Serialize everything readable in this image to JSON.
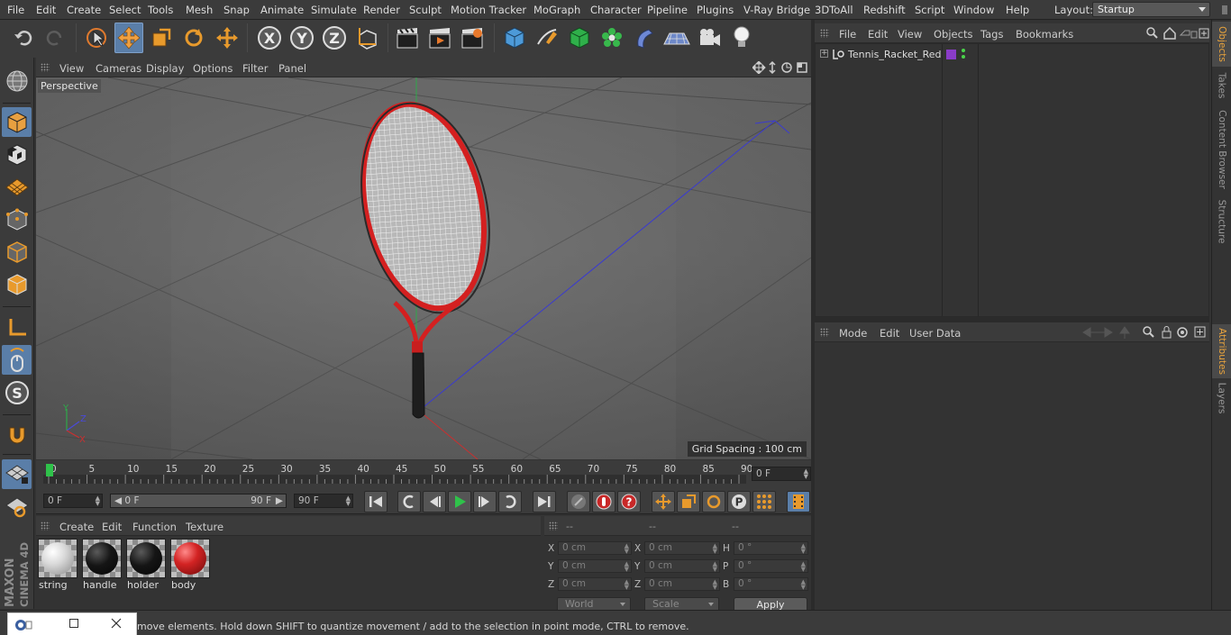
{
  "menubar": {
    "items": [
      "File",
      "Edit",
      "Create",
      "Select",
      "Tools",
      "Mesh",
      "Snap",
      "Animate",
      "Simulate",
      "Render",
      "Sculpt",
      "Motion Tracker",
      "MoGraph",
      "Character",
      "Pipeline",
      "Plugins",
      "V-Ray Bridge",
      "3DToAll",
      "Redshift",
      "Script",
      "Window",
      "Help"
    ],
    "layout_label": "Layout:",
    "layout_value": "Startup"
  },
  "viewport": {
    "menu": [
      "View",
      "Cameras",
      "Display",
      "Options",
      "Filter",
      "Panel"
    ],
    "label": "Perspective",
    "grid_spacing": "Grid Spacing : 100 cm",
    "axis_labels": {
      "y": "Y",
      "z": "Z",
      "x": "X"
    }
  },
  "timeline": {
    "ticks": [
      "0",
      "5",
      "10",
      "15",
      "20",
      "25",
      "30",
      "35",
      "40",
      "45",
      "50",
      "55",
      "60",
      "65",
      "70",
      "75",
      "80",
      "85",
      "90"
    ],
    "current_frame": "0 F",
    "start_field": "0 F",
    "range_start": "0 F",
    "range_end": "90 F",
    "end_field": "90 F"
  },
  "materials": {
    "menu": [
      "Create",
      "Edit",
      "Function",
      "Texture"
    ],
    "items": [
      {
        "name": "string",
        "color": "#d9d9d9"
      },
      {
        "name": "handle",
        "color": "#151515"
      },
      {
        "name": "holder",
        "color": "#151515"
      },
      {
        "name": "body",
        "color": "#d32323"
      }
    ]
  },
  "coordinates": {
    "headers": [
      "--",
      "--",
      "--"
    ],
    "rows": [
      {
        "l1": "X",
        "v1": "0 cm",
        "l2": "X",
        "v2": "0 cm",
        "l3": "H",
        "v3": "0 °"
      },
      {
        "l1": "Y",
        "v1": "0 cm",
        "l2": "Y",
        "v2": "0 cm",
        "l3": "P",
        "v3": "0 °"
      },
      {
        "l1": "Z",
        "v1": "0 cm",
        "l2": "Z",
        "v2": "0 cm",
        "l3": "B",
        "v3": "0 °"
      }
    ],
    "space": "World",
    "mode": "Scale",
    "apply_label": "Apply"
  },
  "objects": {
    "menu": [
      "File",
      "Edit",
      "View",
      "Objects",
      "Tags",
      "Bookmarks"
    ],
    "items": [
      {
        "name": "Tennis_Racket_Red",
        "tag_color": "#8a3cc8"
      }
    ]
  },
  "attributes": {
    "menu": [
      "Mode",
      "Edit",
      "User Data"
    ]
  },
  "side_tabs": {
    "top": [
      "Objects",
      "Takes",
      "Content Browser",
      "Structure"
    ],
    "bottom": [
      "Attributes",
      "Layers"
    ]
  },
  "status": {
    "text": "move elements. Hold down SHIFT to quantize movement / add to the selection in point mode, CTRL to remove."
  },
  "brand": {
    "maxon": "MAXON",
    "product": "CINEMA 4D"
  },
  "colors": {
    "accent": "#5a7ea8",
    "tab_active": "#e8a33d",
    "racket_red": "#d42020"
  }
}
